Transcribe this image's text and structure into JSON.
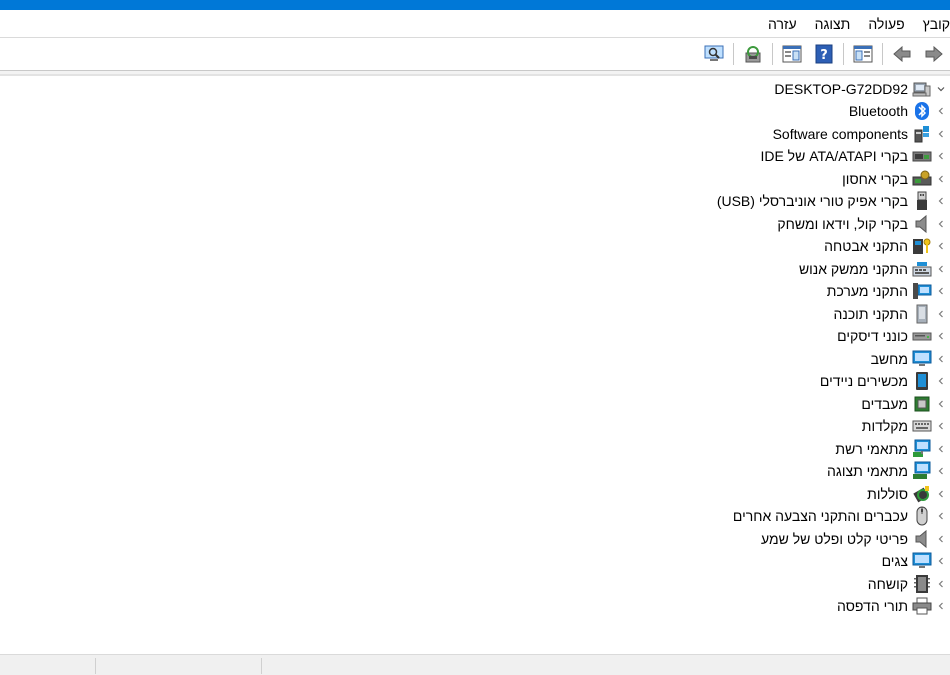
{
  "menu": {
    "file": "קובץ",
    "action": "פעולה",
    "view": "תצוגה",
    "help": "עזרה"
  },
  "tree": {
    "root_label": "DESKTOP-G72DD92",
    "items": [
      {
        "label": "Bluetooth",
        "icon": "bluetooth-icon"
      },
      {
        "label": "Software components",
        "icon": "software-components-icon"
      },
      {
        "label": "בקרי ATA/ATAPI של IDE",
        "icon": "ide-controller-icon"
      },
      {
        "label": "בקרי אחסון",
        "icon": "storage-controller-icon"
      },
      {
        "label": "בקרי אפיק טורי אוניברסלי (USB)",
        "icon": "usb-icon"
      },
      {
        "label": "בקרי קול, וידאו ומשחק",
        "icon": "speaker-icon"
      },
      {
        "label": "התקני אבטחה",
        "icon": "security-device-icon"
      },
      {
        "label": "התקני ממשק אנוש",
        "icon": "hid-icon"
      },
      {
        "label": "התקני מערכת",
        "icon": "system-devices-icon"
      },
      {
        "label": "התקני תוכנה",
        "icon": "software-device-icon"
      },
      {
        "label": "כונני דיסקים",
        "icon": "disk-drive-icon"
      },
      {
        "label": "מחשב",
        "icon": "computer-icon"
      },
      {
        "label": "מכשירים ניידים",
        "icon": "portable-device-icon"
      },
      {
        "label": "מעבדים",
        "icon": "processor-icon"
      },
      {
        "label": "מקלדות",
        "icon": "keyboard-icon"
      },
      {
        "label": "מתאמי רשת",
        "icon": "network-adapter-icon"
      },
      {
        "label": "מתאמי תצוגה",
        "icon": "display-adapter-icon"
      },
      {
        "label": "סוללות",
        "icon": "battery-icon"
      },
      {
        "label": "עכברים והתקני הצבעה אחרים",
        "icon": "mouse-icon"
      },
      {
        "label": "פריטי קלט ופלט של שמע",
        "icon": "audio-io-icon"
      },
      {
        "label": "צגים",
        "icon": "monitor-icon"
      },
      {
        "label": "קושחה",
        "icon": "firmware-icon"
      },
      {
        "label": "תורי הדפסה",
        "icon": "print-queue-icon"
      }
    ]
  },
  "colors": {
    "titlebar": "#0078d7",
    "statusbar": "#f0f0f0"
  }
}
